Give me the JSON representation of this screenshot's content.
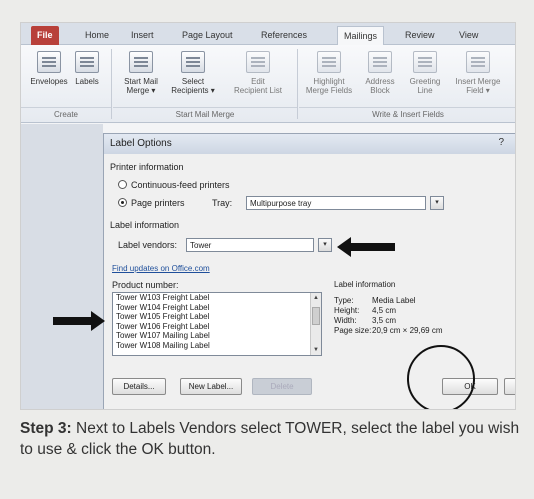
{
  "ribbon": {
    "tabs": [
      "File",
      "Home",
      "Insert",
      "Page Layout",
      "References",
      "Mailings",
      "Review",
      "View"
    ],
    "buttons": [
      {
        "line1": "Envelopes",
        "line2": ""
      },
      {
        "line1": "Labels",
        "line2": ""
      },
      {
        "line1": "Start Mail",
        "line2": "Merge ▾"
      },
      {
        "line1": "Select",
        "line2": "Recipients ▾"
      },
      {
        "line1": "Edit",
        "line2": "Recipient List"
      },
      {
        "line1": "Highlight",
        "line2": "Merge Fields"
      },
      {
        "line1": "Address",
        "line2": "Block"
      },
      {
        "line1": "Greeting",
        "line2": "Line"
      },
      {
        "line1": "Insert Merge",
        "line2": "Field ▾"
      }
    ],
    "groups": [
      "Create",
      "Start Mail Merge",
      "Write & Insert Fields"
    ]
  },
  "dialog": {
    "title": "Label Options",
    "help": "?",
    "printer_info_label": "Printer information",
    "radio_continuous": "Continuous-feed printers",
    "radio_page": "Page printers",
    "tray_label": "Tray:",
    "tray_value": "Multipurpose tray",
    "label_info_label": "Label information",
    "vendors_label": "Label vendors:",
    "vendors_value": "Tower",
    "find_updates": "Find updates on Office.com",
    "product_number_label": "Product number:",
    "products": [
      "Tower W103 Freight Label",
      "Tower W104 Freight Label",
      "Tower W105 Freight Label",
      "Tower W106 Freight Label",
      "Tower W107 Mailing Label",
      "Tower W108 Mailing Label"
    ],
    "label_information": {
      "heading": "Label information",
      "type_key": "Type:",
      "type_val": "Media Label",
      "height_key": "Height:",
      "height_val": "4,5 cm",
      "width_key": "Width:",
      "width_val": "3,5 cm",
      "page_key": "Page size:",
      "page_val": "20,9 cm × 29,69 cm"
    },
    "buttons": {
      "details": "Details...",
      "new_label": "New Label...",
      "delete": "Delete",
      "ok": "OK",
      "cancel": "Canc"
    }
  },
  "caption": {
    "step": "Step 3:",
    "text": " Next to Labels Vendors select TOWER, select the label you wish to use & click the OK button."
  },
  "colors": {
    "file_tab": "#b8403a",
    "background": "#ececea"
  }
}
